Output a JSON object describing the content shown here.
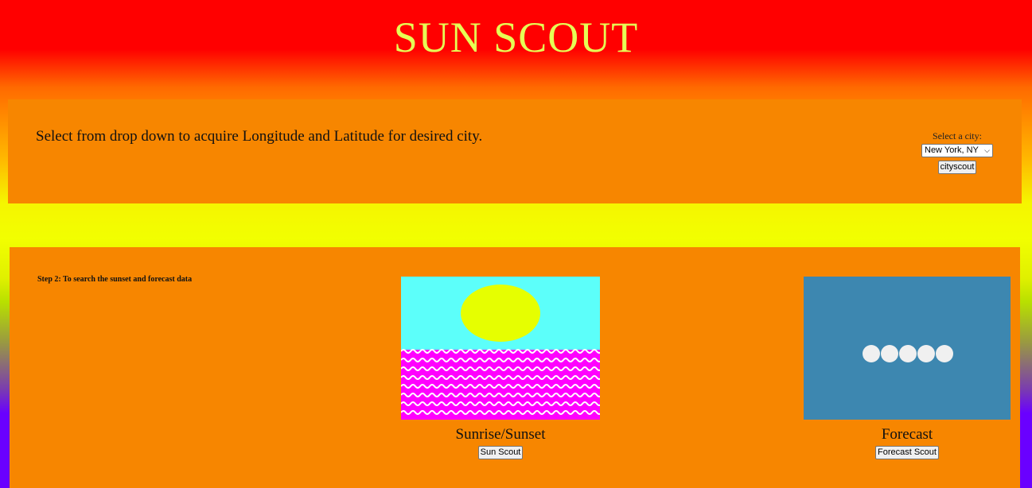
{
  "header": {
    "title": "SUN SCOUT"
  },
  "city_panel": {
    "instruction": "Select from drop down to acquire Longitude and Latitude for desired city.",
    "select_label": "Select a city:",
    "selected_city": "New York, NY",
    "button_label": "cityscout"
  },
  "scout_panel": {
    "step_text": "Step 2: To search the sunset and forecast data",
    "sun_card": {
      "caption": "Sunrise/Sunset",
      "button_label": "Sun Scout"
    },
    "forecast_card": {
      "caption": "Forecast",
      "button_label": "Forecast Scout"
    }
  },
  "colors": {
    "title": "#e6ff55",
    "panel": "#f78600",
    "sky": "#5cfffa",
    "sun": "#e6ff00",
    "sea": "#ff00ff",
    "forecast_bg": "#3d87b0"
  }
}
